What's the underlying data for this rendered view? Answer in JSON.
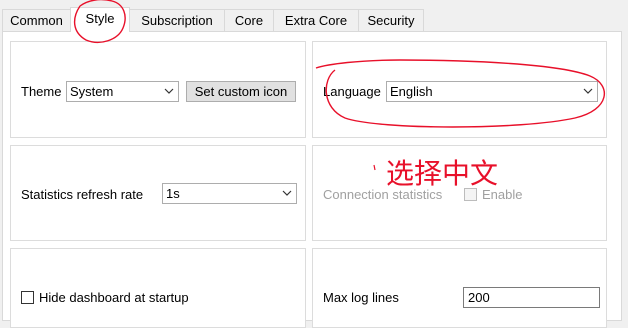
{
  "tabs": [
    {
      "label": "Common"
    },
    {
      "label": "Style"
    },
    {
      "label": "Subscription"
    },
    {
      "label": "Core"
    },
    {
      "label": "Extra Core"
    },
    {
      "label": "Security"
    }
  ],
  "theme": {
    "label": "Theme",
    "value": "System",
    "custom_icon_button": "Set custom icon"
  },
  "language": {
    "label": "Language",
    "value": "English"
  },
  "stats": {
    "label": "Statistics refresh rate",
    "value": "1s"
  },
  "connection": {
    "label": "Connection statistics",
    "checkbox_label": "Enable"
  },
  "dashboard": {
    "checkbox_label": "Hide dashboard at startup"
  },
  "log": {
    "label": "Max log lines",
    "value": "200"
  },
  "annotation": {
    "text": "选择中文",
    "color": "#e8102a"
  }
}
